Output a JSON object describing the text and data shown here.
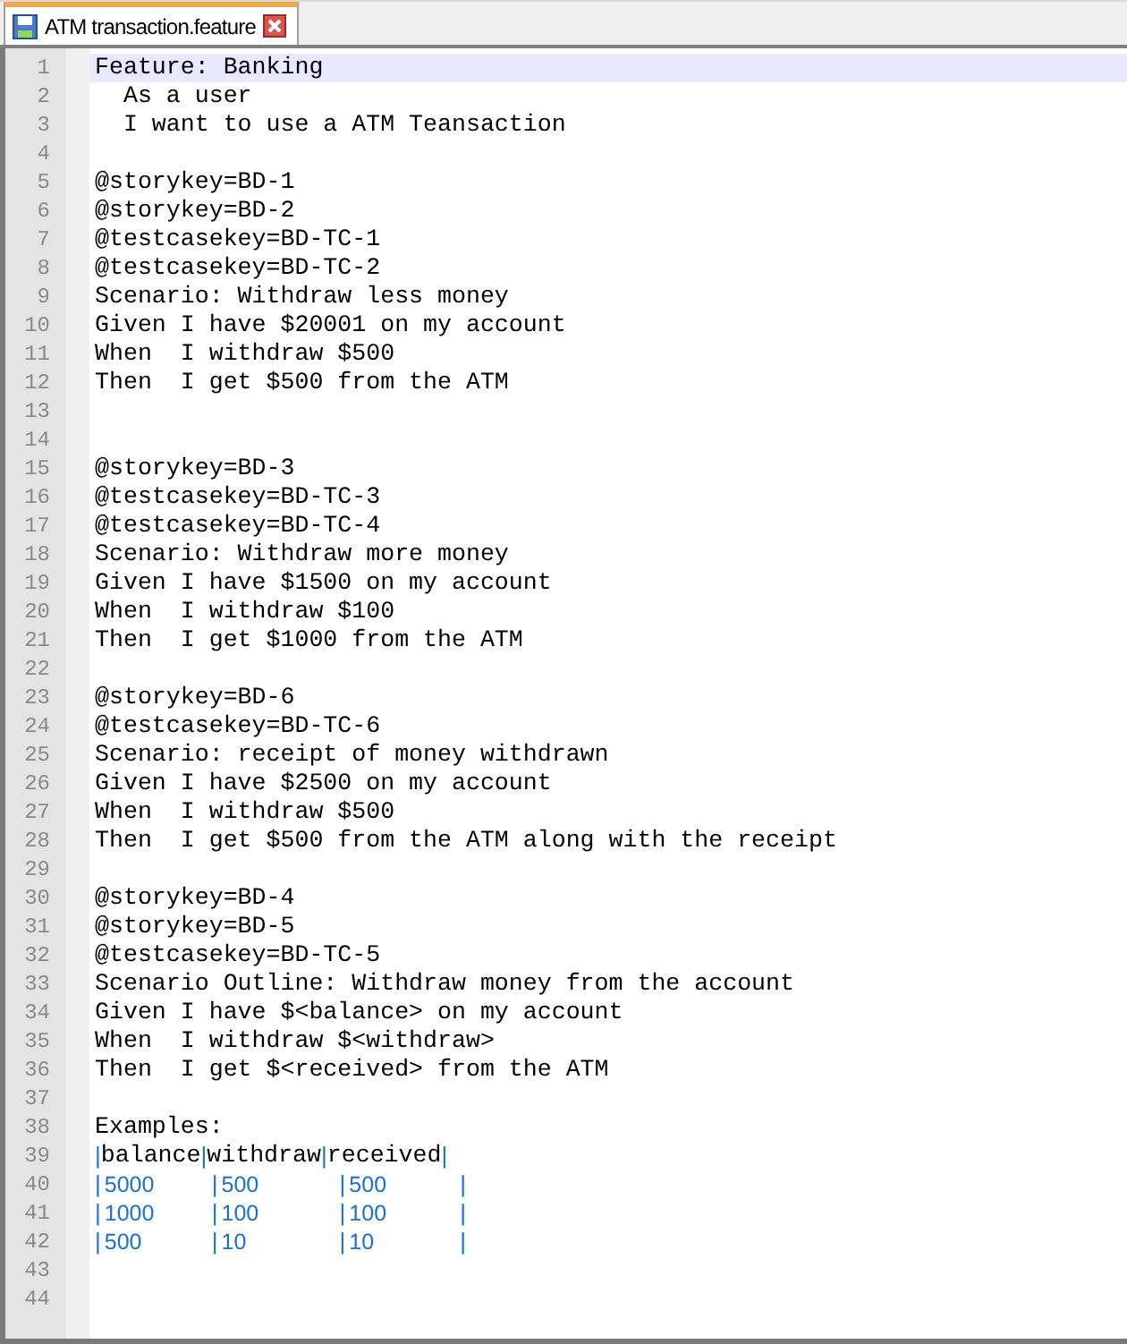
{
  "tabs": [
    {
      "label": "ATM transaction.feature",
      "selected": true
    }
  ],
  "editor": {
    "lines": [
      {
        "number": "1",
        "kind": "text",
        "current": true,
        "text": "Feature: Banking"
      },
      {
        "number": "2",
        "kind": "text",
        "current": false,
        "text": "  As a user"
      },
      {
        "number": "3",
        "kind": "text",
        "current": false,
        "text": "  I want to use a ATM Teansaction"
      },
      {
        "number": "4",
        "kind": "text",
        "current": false
      },
      {
        "number": "5",
        "kind": "text",
        "current": false,
        "text": "@storykey=BD-1"
      },
      {
        "number": "6",
        "kind": "text",
        "current": false,
        "text": "@storykey=BD-2"
      },
      {
        "number": "7",
        "kind": "text",
        "current": false,
        "text": "@testcasekey=BD-TC-1"
      },
      {
        "number": "8",
        "kind": "text",
        "current": false,
        "text": "@testcasekey=BD-TC-2"
      },
      {
        "number": "9",
        "kind": "text",
        "current": false,
        "text": "Scenario: Withdraw less money"
      },
      {
        "number": "10",
        "kind": "text",
        "current": false,
        "text": "Given I have $20001 on my account"
      },
      {
        "number": "11",
        "kind": "text",
        "current": false,
        "text": "When  I withdraw $500"
      },
      {
        "number": "12",
        "kind": "text",
        "current": false,
        "text": "Then  I get $500 from the ATM"
      },
      {
        "number": "13",
        "kind": "text",
        "current": false
      },
      {
        "number": "14",
        "kind": "text",
        "current": false
      },
      {
        "number": "15",
        "kind": "text",
        "current": false,
        "text": "@storykey=BD-3"
      },
      {
        "number": "16",
        "kind": "text",
        "current": false,
        "text": "@testcasekey=BD-TC-3"
      },
      {
        "number": "17",
        "kind": "text",
        "current": false,
        "text": "@testcasekey=BD-TC-4"
      },
      {
        "number": "18",
        "kind": "text",
        "current": false,
        "text": "Scenario: Withdraw more money"
      },
      {
        "number": "19",
        "kind": "text",
        "current": false,
        "text": "Given I have $1500 on my account"
      },
      {
        "number": "20",
        "kind": "text",
        "current": false,
        "text": "When  I withdraw $100"
      },
      {
        "number": "21",
        "kind": "text",
        "current": false,
        "text": "Then  I get $1000 from the ATM"
      },
      {
        "number": "22",
        "kind": "text",
        "current": false
      },
      {
        "number": "23",
        "kind": "text",
        "current": false,
        "text": "@storykey=BD-6"
      },
      {
        "number": "24",
        "kind": "text",
        "current": false,
        "text": "@testcasekey=BD-TC-6"
      },
      {
        "number": "25",
        "kind": "text",
        "current": false,
        "text": "Scenario: receipt of money withdrawn"
      },
      {
        "number": "26",
        "kind": "text",
        "current": false,
        "text": "Given I have $2500 on my account"
      },
      {
        "number": "27",
        "kind": "text",
        "current": false,
        "text": "When  I withdraw $500"
      },
      {
        "number": "28",
        "kind": "text",
        "current": false,
        "text": "Then  I get $500 from the ATM along with the receipt"
      },
      {
        "number": "29",
        "kind": "text",
        "current": false
      },
      {
        "number": "30",
        "kind": "text",
        "current": false,
        "text": "@storykey=BD-4"
      },
      {
        "number": "31",
        "kind": "text",
        "current": false,
        "text": "@storykey=BD-5"
      },
      {
        "number": "32",
        "kind": "text",
        "current": false,
        "text": "@testcasekey=BD-TC-5"
      },
      {
        "number": "33",
        "kind": "text",
        "current": false,
        "text": "Scenario Outline: Withdraw money from the account"
      },
      {
        "number": "34",
        "kind": "text",
        "current": false,
        "text": "Given I have $<balance> on my account"
      },
      {
        "number": "35",
        "kind": "text",
        "current": false,
        "text": "When  I withdraw $<withdraw>"
      },
      {
        "number": "36",
        "kind": "text",
        "current": false,
        "text": "Then  I get $<received> from the ATM"
      },
      {
        "number": "37",
        "kind": "text",
        "current": false
      },
      {
        "number": "38",
        "kind": "text",
        "current": false,
        "text": "Examples:"
      },
      {
        "number": "39",
        "kind": "table-header",
        "current": false,
        "segments": [
          {
            "kind": "pipe",
            "text": "|"
          },
          {
            "kind": "header",
            "text": "balance"
          },
          {
            "kind": "pipe",
            "text": "|"
          },
          {
            "kind": "header",
            "text": "withdraw"
          },
          {
            "kind": "pipe",
            "text": "|"
          },
          {
            "kind": "header",
            "text": "received"
          },
          {
            "kind": "pipe",
            "text": "|"
          }
        ]
      },
      {
        "number": "40",
        "kind": "table-row",
        "current": false,
        "segments": [
          {
            "kind": "pipe",
            "text": "|"
          },
          {
            "kind": "value",
            "text": "5000"
          },
          {
            "kind": "pipe",
            "text": "|"
          },
          {
            "kind": "value",
            "text": "500"
          },
          {
            "kind": "pipe",
            "text": "|"
          },
          {
            "kind": "value",
            "text": "500"
          },
          {
            "kind": "pipe",
            "text": "|"
          }
        ]
      },
      {
        "number": "41",
        "kind": "table-row",
        "current": false,
        "segments": [
          {
            "kind": "pipe",
            "text": "|"
          },
          {
            "kind": "value",
            "text": "1000"
          },
          {
            "kind": "pipe",
            "text": "|"
          },
          {
            "kind": "value",
            "text": "100"
          },
          {
            "kind": "pipe",
            "text": "|"
          },
          {
            "kind": "value",
            "text": "100"
          },
          {
            "kind": "pipe",
            "text": "|"
          }
        ]
      },
      {
        "number": "42",
        "kind": "table-row",
        "current": false,
        "segments": [
          {
            "kind": "pipe",
            "text": "|"
          },
          {
            "kind": "value",
            "text": "500"
          },
          {
            "kind": "pipe",
            "text": "|"
          },
          {
            "kind": "value",
            "text": "10"
          },
          {
            "kind": "pipe",
            "text": "|"
          },
          {
            "kind": "value",
            "text": "10"
          },
          {
            "kind": "pipe",
            "text": "|"
          }
        ]
      },
      {
        "number": "43",
        "kind": "text",
        "current": false
      },
      {
        "number": "44",
        "kind": "text",
        "current": false
      }
    ]
  }
}
